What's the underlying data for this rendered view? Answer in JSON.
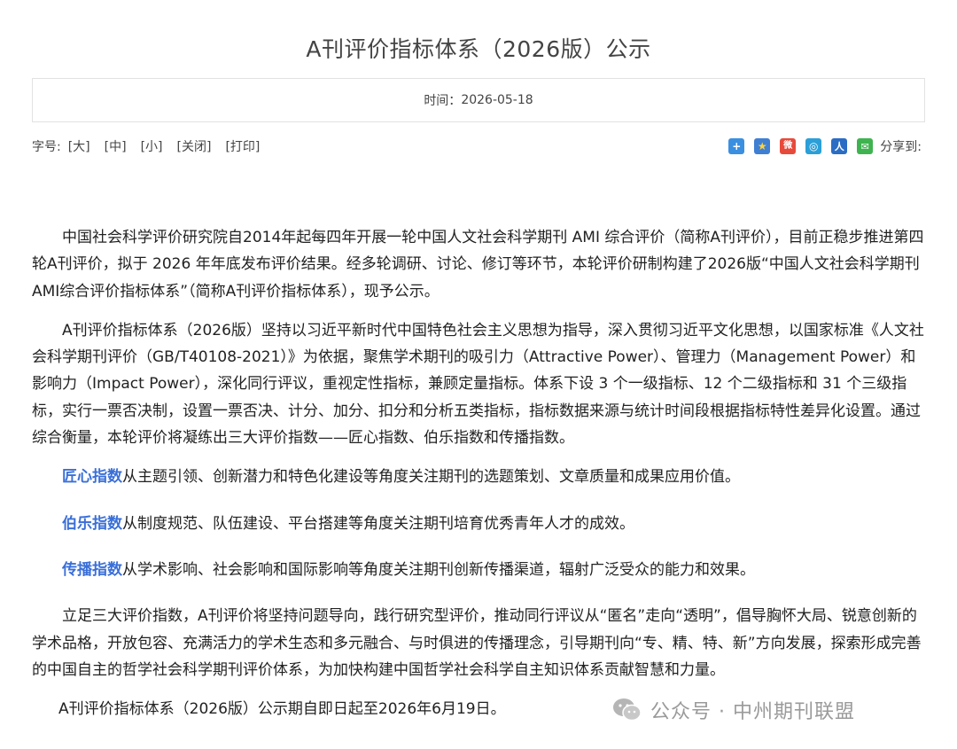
{
  "page": {
    "title": "A刊评价指标体系（2026版）公示",
    "time_label": "时间：",
    "time_value": "2026-05-18"
  },
  "toolbar": {
    "fontsize_label": "字号:",
    "links": [
      "[大]",
      "[中]",
      "[小]",
      "[关闭]",
      "[打印]"
    ],
    "share_label": "分享到:",
    "share_icons": [
      {
        "name": "qzone-share-icon",
        "glyph": "+",
        "color": "#3b8fe0"
      },
      {
        "name": "favorite-star-share-icon",
        "glyph": "★",
        "color": "#3e7fd3"
      },
      {
        "name": "weibo-share-icon",
        "glyph": "微",
        "color": "#e74a3b"
      },
      {
        "name": "tencent-weibo-share-icon",
        "glyph": "◎",
        "color": "#2b9fd8"
      },
      {
        "name": "renren-share-icon",
        "glyph": "人",
        "color": "#2b6cc4"
      },
      {
        "name": "wechat-share-icon",
        "glyph": "✉",
        "color": "#3fb34f"
      }
    ]
  },
  "article": {
    "p1": "中国社会科学评价研究院自2014年起每四年开展一轮中国人文社会科学期刊 AMI 综合评价（简称A刊评价），目前正稳步推进第四轮A刊评价，拟于 2026 年年底发布评价结果。经多轮调研、讨论、修订等环节，本轮评价研制构建了2026版“中国人文社会科学期刊AMI综合评价指标体系”（简称A刊评价指标体系），现予公示。",
    "p2": "A刊评价指标体系（2026版）坚持以习近平新时代中国特色社会主义思想为指导，深入贯彻习近平文化思想，以国家标准《人文社会科学期刊评价（GB/T40108-2021）》为依据，聚焦学术期刊的吸引力（Attractive Power）、管理力（Management Power）和影响力（Impact Power），深化同行评议，重视定性指标，兼顾定量指标。体系下设 3 个一级指标、12 个二级指标和 31 个三级指标，实行一票否决制，设置一票否决、计分、加分、扣分和分析五类指标，指标数据来源与统计时间段根据指标特性差异化设置。通过综合衡量，本轮评价将凝练出三大评价指数——匠心指数、伯乐指数和传播指数。",
    "p3_hl": "匠心指数",
    "p3_text": "从主题引领、创新潜力和特色化建设等角度关注期刊的选题策划、文章质量和成果应用价值。",
    "p4_hl": "伯乐指数",
    "p4_text": "从制度规范、队伍建设、平台搭建等角度关注期刊培育优秀青年人才的成效。",
    "p5_hl": "传播指数",
    "p5_text": "从学术影响、社会影响和国际影响等角度关注期刊创新传播渠道，辐射广泛受众的能力和效果。",
    "p6": "立足三大评价指数，A刊评价将坚持问题导向，践行研究型评价，推动同行评议从“匿名”走向“透明”，倡导胸怀大局、锐意创新的学术品格，开放包容、充满活力的学术生态和多元融合、与时俱进的传播理念，引导期刊向“专、精、特、新”方向发展，探索形成完善的中国自主的哲学社会科学期刊评价体系，为加快构建中国哲学社会科学自主知识体系贡献智慧和力量。",
    "p7": "A刊评价指标体系（2026版）公示期自即日起至2026年6月19日。"
  },
  "watermark": {
    "text": "公众号 · 中州期刊联盟"
  }
}
